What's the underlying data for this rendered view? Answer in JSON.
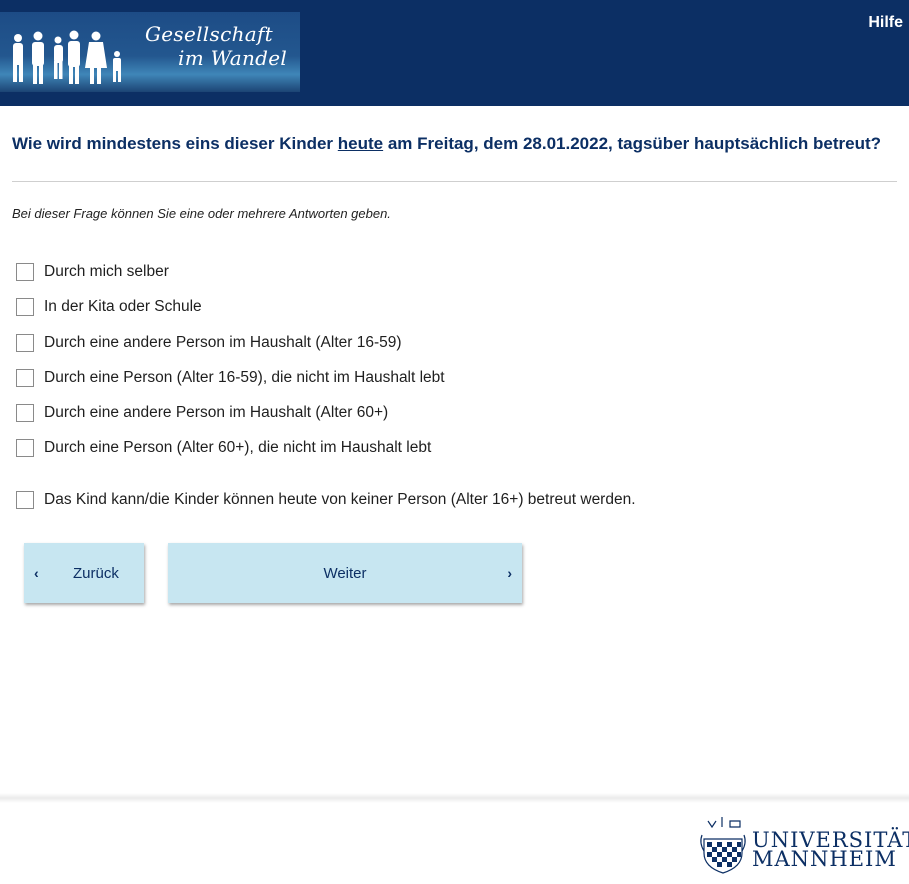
{
  "header": {
    "logo_line1": "Gesellschaft",
    "logo_line2": "im Wandel",
    "help_label": "Hilfe",
    "bg_color": "#0c2f64"
  },
  "question": {
    "before": "Wie wird mindestens eins dieser Kinder ",
    "underlined": "heute",
    "after": " am Freitag, dem 28.01.2022, tagsüber hauptsächlich betreut?"
  },
  "hint": "Bei dieser Frage können Sie eine oder mehrere Antworten geben.",
  "options": [
    {
      "label": "Durch mich selber",
      "checked": false
    },
    {
      "label": "In der Kita oder Schule",
      "checked": false
    },
    {
      "label": "Durch eine andere Person im Haushalt (Alter 16-59)",
      "checked": false
    },
    {
      "label": "Durch eine Person (Alter 16-59), die nicht im Haushalt lebt",
      "checked": false
    },
    {
      "label": "Durch eine andere Person im Haushalt (Alter 60+)",
      "checked": false
    },
    {
      "label": "Durch eine Person (Alter 60+), die nicht im Haushalt lebt",
      "checked": false
    },
    {
      "label": "Das Kind kann/die Kinder können heute von keiner Person (Alter 16+) betreut werden.",
      "checked": false
    }
  ],
  "nav": {
    "back_label": "Zurück",
    "next_label": "Weiter",
    "back_icon": "chevron-left-icon",
    "next_icon": "chevron-right-icon",
    "button_color": "#c7e6f1"
  },
  "footer": {
    "uni_line1": "UNIVERSITÄT",
    "uni_line2": "MANNHEIM"
  }
}
